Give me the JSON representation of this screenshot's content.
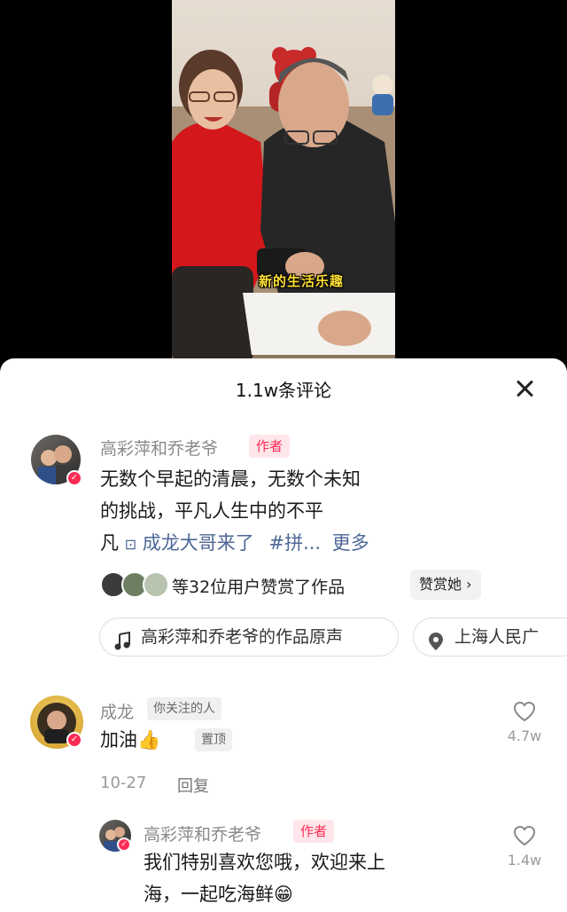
{
  "video": {
    "caption": "新的生活乐趣"
  },
  "sheet": {
    "title": "1.1w条评论"
  },
  "post": {
    "author": "高彩萍和乔老爷",
    "author_tag": "作者",
    "text_line1": "无数个早起的清晨，无数个未知",
    "text_line2": "的挑战，平凡人生中的不平",
    "text_line3_prefix": "凡",
    "mention": "成龙大哥来了",
    "hashtag": "#拼...",
    "more": "更多",
    "tip_text": "等32位用户赞赏了作品",
    "tip_button": "赞赏她 ›",
    "music_label": "高彩萍和乔老爷的作品原声",
    "location_label": "上海人民广"
  },
  "comments": [
    {
      "name": "成龙",
      "badge": "你关注的人",
      "text": "加油👍",
      "pin_badge": "置顶",
      "date": "10-27",
      "reply_label": "回复",
      "like_count": "4.7w"
    }
  ],
  "reply": {
    "name": "高彩萍和乔老爷",
    "tag": "作者",
    "line1": "我们特别喜欢您哦，欢迎来上",
    "line2": "海，一起吃海鲜😁",
    "like_count": "1.4w"
  },
  "colors": {
    "accent": "#fe2c55",
    "link": "#4c6796",
    "muted": "#8a8a8a"
  }
}
